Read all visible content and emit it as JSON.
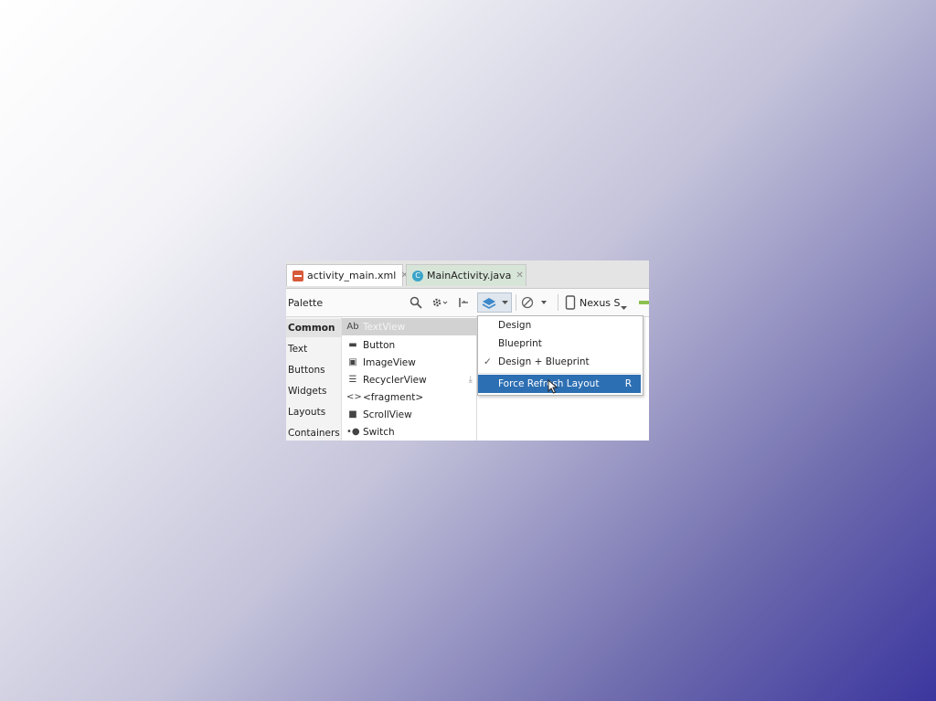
{
  "tabs": [
    {
      "label": "activity_main.xml",
      "icon": "xml-file-icon",
      "active": true
    },
    {
      "label": "MainActivity.java",
      "icon": "java-class-icon",
      "active": false
    }
  ],
  "toolbar": {
    "palette_title": "Palette",
    "device": "Nexus S"
  },
  "categories": [
    "Common",
    "Text",
    "Buttons",
    "Widgets",
    "Layouts",
    "Containers"
  ],
  "widgets": [
    {
      "icon": "Ab",
      "label": "TextView"
    },
    {
      "icon": "▬",
      "label": "Button"
    },
    {
      "icon": "▣",
      "label": "ImageView"
    },
    {
      "icon": "☰",
      "label": "RecyclerView"
    },
    {
      "icon": "<>",
      "label": "<fragment>"
    },
    {
      "icon": "■",
      "label": "ScrollView"
    },
    {
      "icon": "•●",
      "label": "Switch"
    }
  ],
  "menu": {
    "items": [
      {
        "label": "Design",
        "checked": false
      },
      {
        "label": "Blueprint",
        "checked": false
      },
      {
        "label": "Design + Blueprint",
        "checked": true
      }
    ],
    "action": {
      "label": "Force Refresh Layout",
      "shortcut": "R"
    }
  },
  "colors": {
    "highlight": "#2d6fb3",
    "background_light": "#ffffff",
    "background_dark": "#3b369e"
  }
}
